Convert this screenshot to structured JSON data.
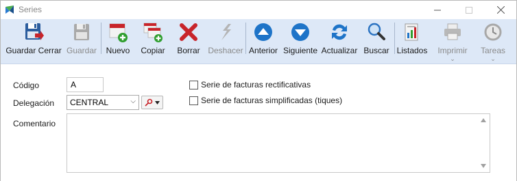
{
  "window": {
    "title": "Series"
  },
  "toolbar": {
    "items": [
      {
        "id": "guardar-cerrar",
        "label": "Guardar Cerrar",
        "icon": "save-close-icon",
        "enabled": true
      },
      {
        "id": "guardar",
        "label": "Guardar",
        "icon": "save-icon",
        "enabled": false
      },
      {
        "id": "nuevo",
        "label": "Nuevo",
        "icon": "new-document-icon",
        "enabled": true
      },
      {
        "id": "copiar",
        "label": "Copiar",
        "icon": "copy-icon",
        "enabled": true
      },
      {
        "id": "borrar",
        "label": "Borrar",
        "icon": "delete-icon",
        "enabled": true
      },
      {
        "id": "deshacer",
        "label": "Deshacer",
        "icon": "undo-icon",
        "enabled": false
      },
      {
        "id": "anterior",
        "label": "Anterior",
        "icon": "arrow-up-icon",
        "enabled": true
      },
      {
        "id": "siguiente",
        "label": "Siguiente",
        "icon": "arrow-down-icon",
        "enabled": true
      },
      {
        "id": "actualizar",
        "label": "Actualizar",
        "icon": "refresh-icon",
        "enabled": true
      },
      {
        "id": "buscar",
        "label": "Buscar",
        "icon": "search-icon",
        "enabled": true
      },
      {
        "id": "listados",
        "label": "Listados",
        "icon": "report-icon",
        "enabled": true
      },
      {
        "id": "imprimir",
        "label": "Imprimir",
        "icon": "printer-icon",
        "enabled": false,
        "dropdown": true
      },
      {
        "id": "tareas",
        "label": "Tareas",
        "icon": "tasks-clock-icon",
        "enabled": false,
        "dropdown": true
      }
    ]
  },
  "form": {
    "codigo_label": "Código",
    "codigo_value": "A",
    "delegacion_label": "Delegación",
    "delegacion_value": "CENTRAL",
    "comentario_label": "Comentario",
    "comentario_value": "",
    "rectificativas_label": "Serie de facturas rectificativas",
    "rectificativas_checked": false,
    "simplificadas_label": "Serie de facturas simplificadas (tiques)",
    "simplificadas_checked": false
  },
  "colors": {
    "toolbar_bg": "#dde8f7",
    "accent_blue": "#1e74c8",
    "delete_red": "#c8242a",
    "add_green": "#2f9e2f"
  }
}
